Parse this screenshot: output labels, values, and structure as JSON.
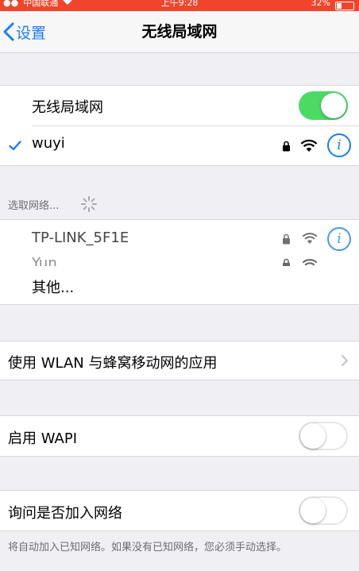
{
  "status_bar": {
    "carrier": "中国联通",
    "time": "上午9:28",
    "battery": "32%"
  },
  "nav": {
    "back_label": "设置",
    "title": "无线局域网"
  },
  "wlan": {
    "toggle_label": "无线局域网",
    "toggle_on": true,
    "connected_network": "wuyi",
    "info_glyph": "i"
  },
  "choose_network": {
    "caption": "选取网络...",
    "networks": [
      {
        "name": "TP-LINK_5F1E",
        "locked": true
      },
      {
        "name": "Yun",
        "locked": true
      }
    ],
    "other_label": "其他..."
  },
  "apps_row": {
    "label": "使用 WLAN 与蜂窝移动网的应用"
  },
  "wapi": {
    "label": "启用 WAPI",
    "toggle_on": false
  },
  "ask_join": {
    "label": "询问是否加入网络",
    "toggle_on": false,
    "footer": "将自动加入已知网络。如果没有已知网络，您必须手动选择。"
  },
  "colors": {
    "accent": "#1a7cf0",
    "toggle_on": "#4cd964",
    "status_bar": "#f0442c"
  },
  "icons": [
    "back-chevron-icon",
    "checkmark-icon",
    "lock-icon",
    "wifi-icon",
    "info-icon",
    "spinner-icon",
    "chevron-right-icon"
  ]
}
